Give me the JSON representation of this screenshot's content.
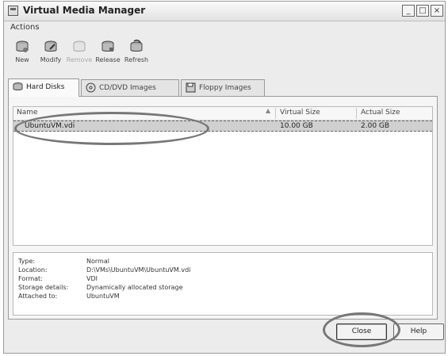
{
  "window": {
    "title": "Virtual Media Manager",
    "minimize": "_",
    "maximize": "□",
    "close": "×"
  },
  "menubar": {
    "items": [
      "Actions"
    ]
  },
  "toolbar": {
    "items": [
      {
        "label": "New",
        "icon": "disk-new-icon",
        "enabled": true
      },
      {
        "label": "Modify",
        "icon": "disk-modify-icon",
        "enabled": true
      },
      {
        "label": "Remove",
        "icon": "disk-remove-icon",
        "enabled": false
      },
      {
        "label": "Release",
        "icon": "disk-release-icon",
        "enabled": true
      },
      {
        "label": "Refresh",
        "icon": "refresh-icon",
        "enabled": true
      }
    ]
  },
  "tabs": [
    {
      "label": "Hard Disks",
      "icon": "hard-disk-icon",
      "active": true
    },
    {
      "label": "CD/DVD Images",
      "icon": "cd-dvd-icon",
      "active": false
    },
    {
      "label": "Floppy Images",
      "icon": "floppy-icon",
      "active": false
    }
  ],
  "table": {
    "columns": [
      "Name",
      "Virtual Size",
      "Actual Size"
    ],
    "rows": [
      {
        "name": "UbuntuVM.vdi",
        "virtual_size": "10.00 GB",
        "actual_size": "2.00 GB"
      }
    ]
  },
  "details": [
    {
      "label": "Type:",
      "value": "Normal"
    },
    {
      "label": "Location:",
      "value": "D:\\VMs\\UbuntuVM\\UbuntuVM.vdi"
    },
    {
      "label": "Format:",
      "value": "VDI"
    },
    {
      "label": "Storage details:",
      "value": "Dynamically allocated storage"
    },
    {
      "label": "Attached to:",
      "value": "UbuntuVM"
    }
  ],
  "buttons": {
    "close": "Close",
    "help": "Help"
  },
  "colors": {
    "selection": "#d0d0d0",
    "annotation": "#777777"
  }
}
